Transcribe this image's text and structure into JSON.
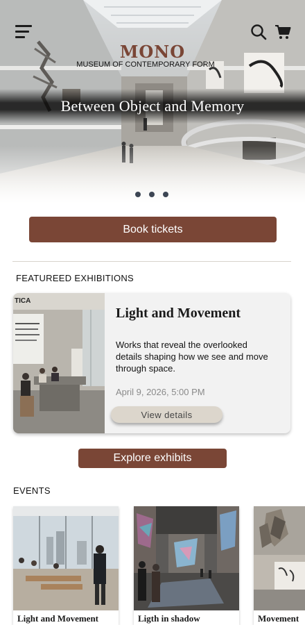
{
  "header": {
    "logo": "MONO",
    "logo_subtitle": "MUSEUM OF CONTEMPORARY FORM",
    "menu_icon": "hamburger-icon",
    "search_icon": "search-icon",
    "cart_icon": "cart-icon"
  },
  "hero": {
    "title": "Between Object and Memory",
    "carousel_dots": 3
  },
  "actions": {
    "book_tickets": "Book tickets",
    "explore_exhibits": "Explore exhibits"
  },
  "featured": {
    "section_title": "FEATUREED EXHIBITIONS",
    "card": {
      "image_text": "TICA",
      "title": "Light and Movement",
      "description": "Works that reveal the overlooked details shaping how we see and move through space.",
      "date": "April 9, 2026, 5:00 PM",
      "button": "View details"
    }
  },
  "events": {
    "section_title": "EVENTS",
    "items": [
      {
        "label": "Light and Movement"
      },
      {
        "label": "Ligth in shadow"
      },
      {
        "label": "Movement"
      }
    ]
  },
  "colors": {
    "accent": "#7a4636",
    "dot": "#3d4654",
    "card_bg": "#f2f2f2",
    "secondary_button": "#dcd6cc"
  }
}
